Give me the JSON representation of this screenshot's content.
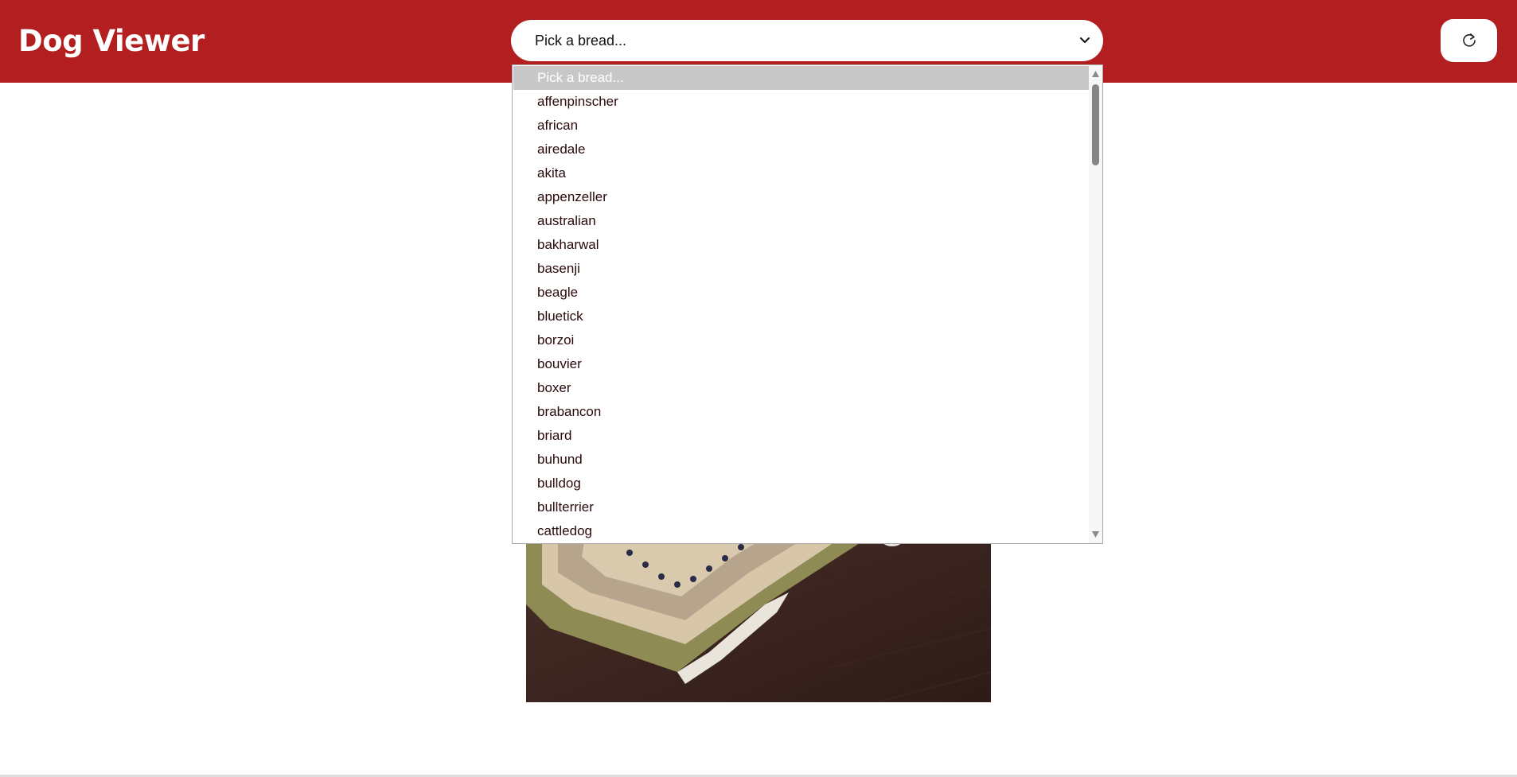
{
  "header": {
    "title": "Dog Viewer",
    "background_color": "#b31f21"
  },
  "breed_select": {
    "selected_value": "Pick a bread...",
    "options": [
      "Pick a bread...",
      "affenpinscher",
      "african",
      "airedale",
      "akita",
      "appenzeller",
      "australian",
      "bakharwal",
      "basenji",
      "beagle",
      "bluetick",
      "borzoi",
      "bouvier",
      "boxer",
      "brabancon",
      "briard",
      "buhund",
      "bulldog",
      "bullterrier",
      "cattledog"
    ],
    "highlighted_index": 0
  },
  "refresh_button": {
    "icon": "refresh-icon"
  }
}
